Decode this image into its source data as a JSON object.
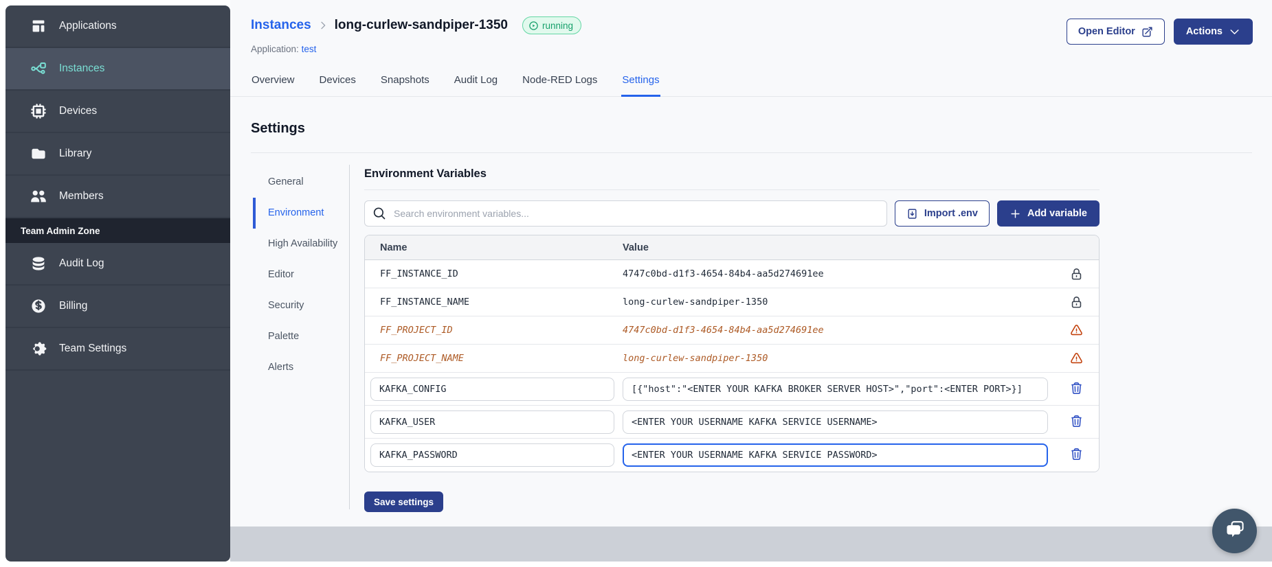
{
  "colors": {
    "sidebar_bg": "#3d4450",
    "sidebar_active_bg": "#4b5362",
    "teal_accent": "#7adfd4",
    "link_blue": "#2563eb",
    "navy_button": "#2b3f8c",
    "running_text": "#17a06b",
    "running_bg": "#e1f9ed",
    "deprecated_text": "#ad5a25",
    "warning_icon": "#c2410c",
    "trash_icon": "#3353c5",
    "focus_border": "#2563eb",
    "footer_band": "#ccd0d7",
    "chat_bg": "#41566b"
  },
  "sidebar": {
    "main_items": [
      {
        "label": "Applications",
        "icon": "applications-icon",
        "active": false
      },
      {
        "label": "Instances",
        "icon": "instances-icon",
        "active": true
      },
      {
        "label": "Devices",
        "icon": "devices-icon",
        "active": false
      },
      {
        "label": "Library",
        "icon": "library-icon",
        "active": false
      },
      {
        "label": "Members",
        "icon": "members-icon",
        "active": false
      }
    ],
    "section_label": "Team Admin Zone",
    "admin_items": [
      {
        "label": "Audit Log",
        "icon": "audit-log-icon",
        "active": false
      },
      {
        "label": "Billing",
        "icon": "billing-icon",
        "active": false
      },
      {
        "label": "Team Settings",
        "icon": "team-settings-icon",
        "active": false
      }
    ]
  },
  "header": {
    "breadcrumb_root": "Instances",
    "instance_name": "long-curlew-sandpiper-1350",
    "status_badge": "running",
    "application_label": "Application:",
    "application_name": "test",
    "open_editor_label": "Open Editor",
    "actions_label": "Actions"
  },
  "tabs": {
    "items": [
      "Overview",
      "Devices",
      "Snapshots",
      "Audit Log",
      "Node-RED Logs",
      "Settings"
    ],
    "active": "Settings"
  },
  "settings": {
    "title": "Settings",
    "nav_items": [
      "General",
      "Environment",
      "High Availability",
      "Editor",
      "Security",
      "Palette",
      "Alerts"
    ],
    "active": "Environment"
  },
  "environment": {
    "title": "Environment Variables",
    "search_placeholder": "Search environment variables...",
    "import_button": "Import .env",
    "add_button": "Add variable",
    "columns": {
      "name": "Name",
      "value": "Value"
    },
    "variables": [
      {
        "name": "FF_INSTANCE_ID",
        "value": "4747c0bd-d1f3-4654-84b4-aa5d274691ee",
        "kind": "locked",
        "focused": false
      },
      {
        "name": "FF_INSTANCE_NAME",
        "value": "long-curlew-sandpiper-1350",
        "kind": "locked",
        "focused": false
      },
      {
        "name": "FF_PROJECT_ID",
        "value": "4747c0bd-d1f3-4654-84b4-aa5d274691ee",
        "kind": "deprecated",
        "focused": false
      },
      {
        "name": "FF_PROJECT_NAME",
        "value": "long-curlew-sandpiper-1350",
        "kind": "deprecated",
        "focused": false
      },
      {
        "name": "KAFKA_CONFIG",
        "value": "[{\"host\":\"<ENTER YOUR KAFKA BROKER SERVER HOST>\",\"port\":<ENTER PORT>}]",
        "kind": "editable",
        "focused": false
      },
      {
        "name": "KAFKA_USER",
        "value": "<ENTER YOUR USERNAME KAFKA SERVICE USERNAME>",
        "kind": "editable",
        "focused": false
      },
      {
        "name": "KAFKA_PASSWORD",
        "value": "<ENTER YOUR USERNAME KAFKA SERVICE PASSWORD>",
        "kind": "editable",
        "focused": true
      }
    ],
    "save_button": "Save settings"
  }
}
